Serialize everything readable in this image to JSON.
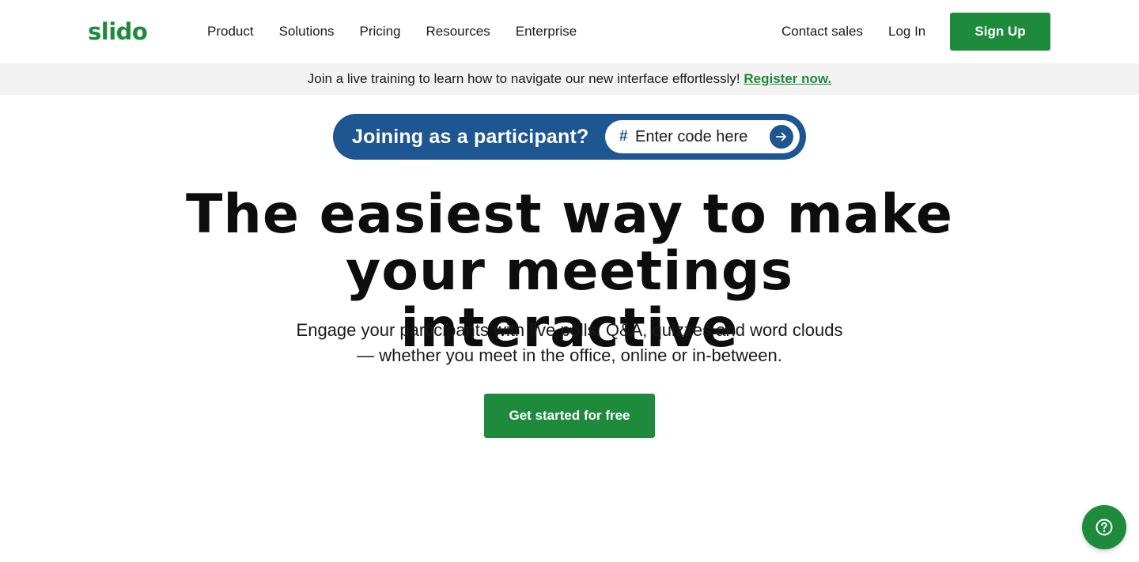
{
  "header": {
    "logo": "slido",
    "nav": [
      "Product",
      "Solutions",
      "Pricing",
      "Resources",
      "Enterprise"
    ],
    "contact_sales": "Contact sales",
    "login": "Log In",
    "signup": "Sign Up"
  },
  "banner": {
    "text": "Join a live training to learn how to navigate our new interface effortlessly!",
    "link": "Register now."
  },
  "participant": {
    "label": "Joining as a participant?",
    "hash": "#",
    "placeholder": "Enter code here"
  },
  "hero": {
    "title_line1": "The easiest way to make",
    "title_line2": "your meetings interactive",
    "subtitle_line1": "Engage your participants with live polls, Q&A, quizzes and word clouds",
    "subtitle_line2": "— whether you meet in the office, online or in-between.",
    "cta": "Get started for free"
  },
  "colors": {
    "brand_green": "#1e8a3c",
    "participant_blue": "#1d5690",
    "banner_bg": "#f3f3f3"
  },
  "icons": {
    "go": "arrow-right-icon",
    "help": "question-circle-icon"
  }
}
